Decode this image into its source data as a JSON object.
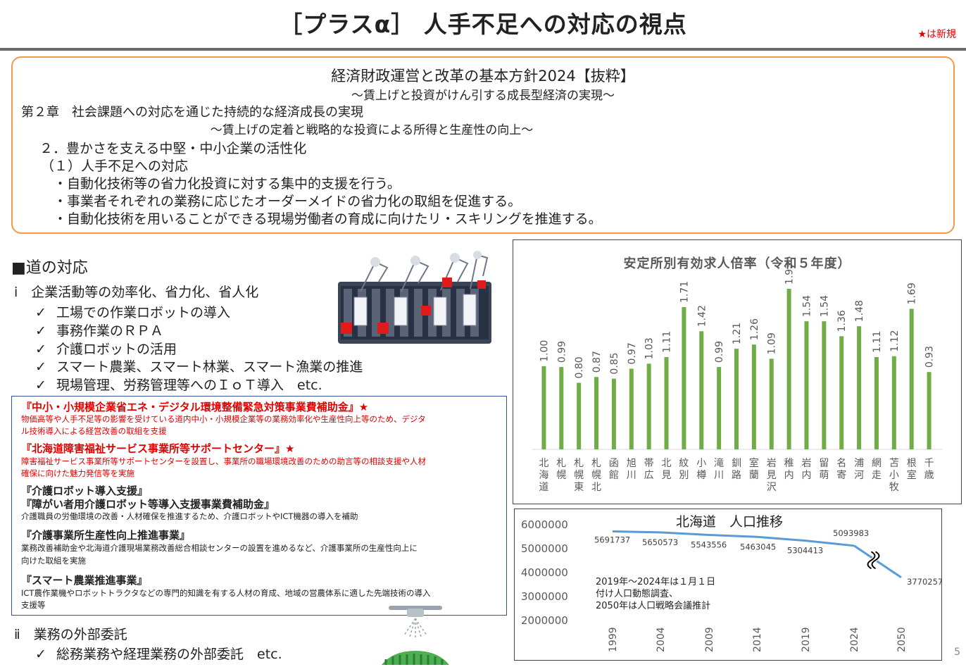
{
  "header": {
    "title": "［プラスα］ 人手不足への対応の視点",
    "new_note": "★は新規"
  },
  "policy": {
    "title": "経済財政運営と改革の基本方針2024【抜粋】",
    "subtitle": "～賃上げと投資がけん引する成長型経済の実現～",
    "chapter": "第２章　社会課題への対応を通じた持続的な経済成長の実現",
    "chapter_sub": "～賃上げの定着と戦略的な投資による所得と生産性の向上～",
    "section": "２．豊かさを支える中堅・中小企業の活性化",
    "subsection": "（１）人手不足への対応",
    "items": [
      "・自動化技術等の省力化投資に対する集中的支援を行う。",
      "・事業者それぞれの業務に応じたオーダーメイドの省力化の取組を促進する。",
      "・自動化技術を用いることができる現場労働者の育成に向けたリ・スキリングを推進する。"
    ]
  },
  "response": {
    "heading": "■道の対応",
    "cat1": "ⅰ　企業活動等の効率化、省力化、省人化",
    "checks1": [
      "工場での作業ロボットの導入",
      "事務作業のＲＰＡ",
      "介護ロボットの活用",
      "スマート農業、スマート林業、スマート漁業の推進",
      "現場管理、労務管理等へのＩｏＴ導入　etc."
    ],
    "cat2": "ⅱ　業務の外部委託",
    "checks2": [
      "総務業務や経理業務の外部委託　etc."
    ],
    "check_mark": "✓"
  },
  "programs": [
    {
      "title": "『中小・小規模企業省エネ・デジタル環境整備緊急対策事業費補助金』★",
      "red": true,
      "desc": [
        "物価高等や人手不足等の影響を受けている道内中小・小規模企業等の業務効率化や生産性向上等のため、デジタ",
        "ル技術導入による経営改善の取組を支援"
      ]
    },
    {
      "title": "『北海道障害福祉サービス事業所等サポートセンター』★",
      "red": true,
      "desc": [
        "障害福祉サービス事業所等サポートセンターを設置し、事業所の職場環境改善のための助言等の相談支援や人材",
        "確保に向けた魅力発信等を実施"
      ]
    },
    {
      "title": "『介護ロボット導入支援』",
      "red": false,
      "desc": []
    },
    {
      "title": "『障がい者用介護ロボット等導入支援事業費補助金』",
      "red": false,
      "desc": [
        "介護職員の労働環境の改善・人材確保を推進するため、介護ロボットやICT機器の導入を補助"
      ]
    },
    {
      "title": "『介護事業所生産性向上推進事業』",
      "red": false,
      "desc": [
        "業務改善補助金や北海道介護現場業務改善総合相談センターの設置を進めるなど、介護事業所の生産性向上に",
        "向けた取組を実施"
      ]
    },
    {
      "title": "『スマート農業推進事業』",
      "red": false,
      "desc": [
        "ICT農作業機やロボットトラクタなどの専門的知識を有する人材の育成、地域の営農体系に適した先端技術の導入",
        "支援等"
      ]
    }
  ],
  "chart_data": [
    {
      "type": "bar",
      "title": "安定所別有効求人倍率（令和５年度）",
      "categories": [
        "北海道",
        "札幌",
        "札幌東",
        "札幌北",
        "函館",
        "旭川",
        "帯広",
        "北見",
        "紋別",
        "小樽",
        "滝川",
        "釧路",
        "室蘭",
        "岩見沢",
        "稚内",
        "岩内",
        "留萌",
        "名寄",
        "浦河",
        "網走",
        "苫小牧",
        "根室",
        "千歳"
      ],
      "values": [
        1.0,
        0.99,
        0.8,
        0.87,
        0.85,
        0.97,
        1.03,
        1.11,
        1.71,
        1.42,
        0.99,
        1.21,
        1.26,
        1.09,
        1.93,
        1.54,
        1.54,
        1.36,
        1.48,
        1.11,
        1.12,
        1.69,
        0.93
      ],
      "value_labels": [
        "1.00",
        "0.99",
        "0.80",
        "0.87",
        "0.85",
        "0.97",
        "1.03",
        "1.11",
        "1.71",
        "1.42",
        "0.99",
        "1.21",
        "1.26",
        "1.09",
        "1.93",
        "1.54",
        "1.54",
        "1.36",
        "1.48",
        "1.11",
        "1.12",
        "1.69",
        "0.93"
      ],
      "ylim": [
        0,
        2.1
      ],
      "color": "#70ad47",
      "grid": true
    },
    {
      "type": "line",
      "title": "北海道　人口推移",
      "x": [
        "1999",
        "2004",
        "2009",
        "2014",
        "2019",
        "2024",
        "2050"
      ],
      "values": [
        5691737,
        5650573,
        5543556,
        5463045,
        5304413,
        5093983,
        3770257
      ],
      "value_labels": [
        "5691737",
        "5650573",
        "5543556",
        "5463045",
        "5304413",
        "5093983",
        "3770257"
      ],
      "ytick_labels": [
        "6000000",
        "5000000",
        "4000000",
        "3000000",
        "2000000"
      ],
      "ylim": [
        2000000,
        6000000
      ],
      "note": [
        "2019年～2024年は１月１日",
        "付け人口動態調査、",
        "2050年は人口戦略会議推計"
      ],
      "color": "#5b9bd5",
      "axis_break": true
    }
  ],
  "page_number": "5"
}
